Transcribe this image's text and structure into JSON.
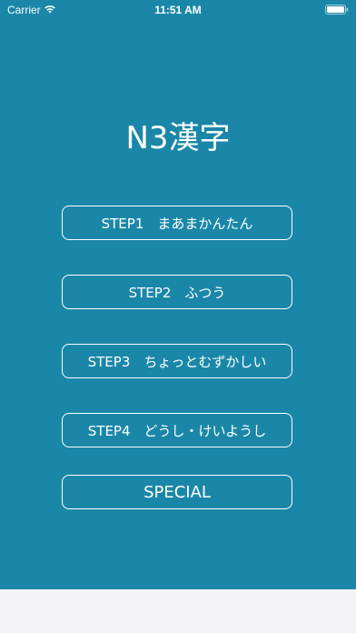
{
  "status_bar": {
    "carrier": "Carrier",
    "time": "11:51 AM",
    "wifi_icon": "wifi-icon",
    "battery_icon": "battery-icon"
  },
  "screen": {
    "title": "N3漢字",
    "background_color": "#1a87a8"
  },
  "menu": {
    "step1": "STEP1　まあまかんたん",
    "step2": "STEP2　ふつう",
    "step3": "STEP3　ちょっとむずかしい",
    "step4": "STEP4　どうし・けいようし",
    "special": "SPECIAL"
  }
}
